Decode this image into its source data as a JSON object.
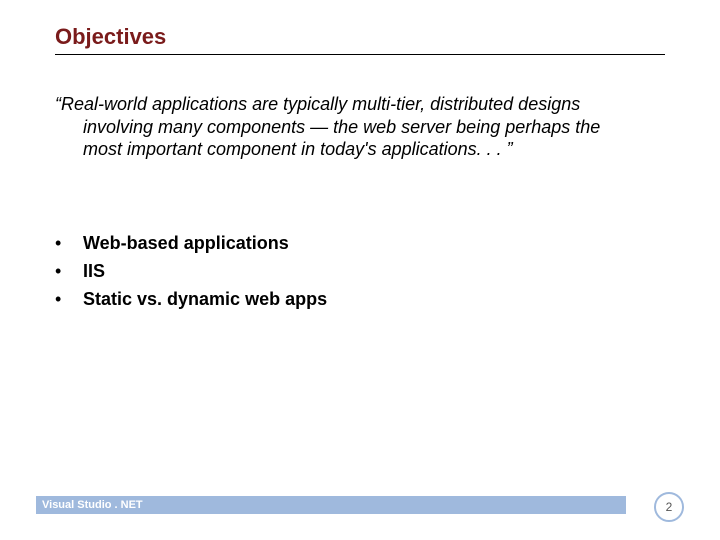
{
  "title": "Objectives",
  "quote": {
    "line1": "“Real-world applications are typically multi-tier, distributed designs",
    "line2": "involving many components — the web server being perhaps the",
    "line3": "most important component in today's applications. . . ”"
  },
  "bullets": [
    "Web-based applications",
    "IIS",
    "Static vs. dynamic web apps"
  ],
  "footer": {
    "label": "Visual Studio . NET"
  },
  "page_number": "2"
}
